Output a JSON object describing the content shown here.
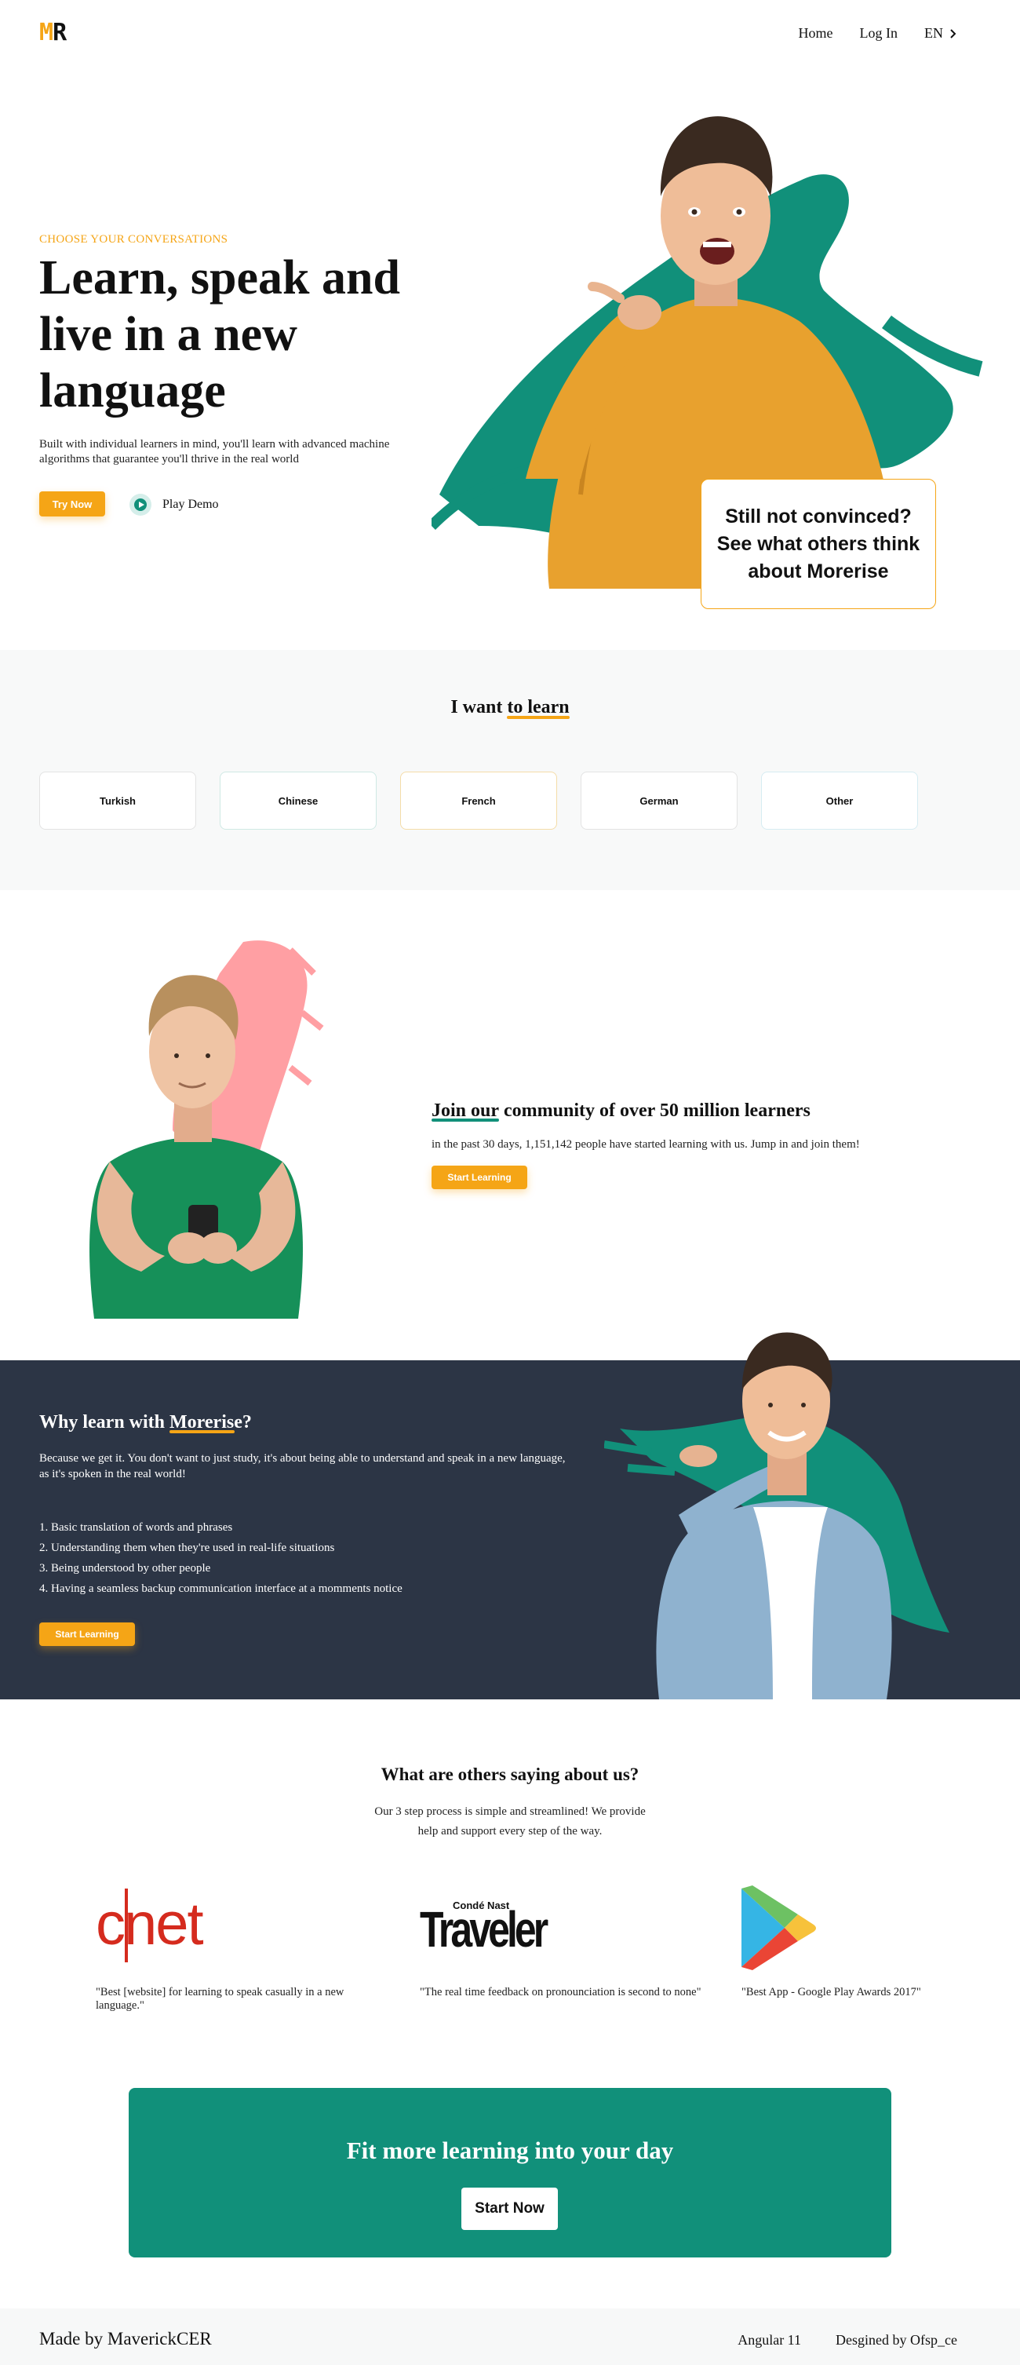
{
  "nav": {
    "logo": "MR",
    "links": [
      "Home",
      "Log In"
    ],
    "language": "EN"
  },
  "hero": {
    "eyebrow": "CHOOSE YOUR CONVERSATIONS",
    "title_part1": "Learn, ",
    "title_highlight": "speak",
    "title_part2": " and live in a new language",
    "description": "Built with individual learners in mind, you'll learn with advanced machine algorithms that guarantee you'll thrive in the real world",
    "try_now_label": "Try Now",
    "play_demo_label": "Play Demo",
    "callout": "Still not convinced? See what others think about Morerise"
  },
  "learn": {
    "title_prefix": "I want ",
    "title_highlight": "to learn",
    "languages": [
      "Turkish",
      "Chinese",
      "French",
      "German",
      "Other"
    ]
  },
  "community": {
    "title_highlight": "Join our",
    "title_rest": " community of over 50 million learners",
    "description": "in the past 30 days, 1,151,142 people have started learning with us. Jump in and join them!",
    "button_label": "Start Learning"
  },
  "why": {
    "title_prefix": "Why learn with ",
    "title_highlight": "Morerise",
    "title_suffix": "?",
    "description": "Because we get it. You don't want to just study, it's about being able to understand and speak in a new language, as it's spoken in the real world!",
    "items": [
      "1.  Basic translation of words and phrases",
      "2.  Understanding them when they're used in real-life situations",
      "3.  Being understood by other people",
      "4.  Having a seamless backup communication interface at a momments notice"
    ],
    "button_label": "Start Learning"
  },
  "testimonials": {
    "title": "What are others saying about us?",
    "description": "Our 3 step process is simple and streamlined! We provide help and support every step of the way.",
    "press": [
      {
        "logo": "cnet-logo",
        "logo_text": "cnet",
        "quote": "\"Best [website] for learning to speak casually in a new language.\""
      },
      {
        "logo": "traveler-logo",
        "logo_small": "Condé Nast",
        "logo_text": "Traveler",
        "quote": "\"The real time feedback on pronounciation is second to none\""
      },
      {
        "logo": "google-play-icon",
        "quote": "\"Best App - Google Play Awards 2017\""
      }
    ]
  },
  "cta": {
    "title": "Fit more learning into your day",
    "button_label": "Start Now"
  },
  "footer": {
    "made_by": "Made by MaverickCER",
    "framework": "Angular 11",
    "designed_by": "Desgined by Ofsp_ce"
  },
  "colors": {
    "accent": "#f5a516",
    "brand_green": "#11907a",
    "dark_panel": "#2c3545",
    "pink_brush": "#ff9fa3"
  }
}
